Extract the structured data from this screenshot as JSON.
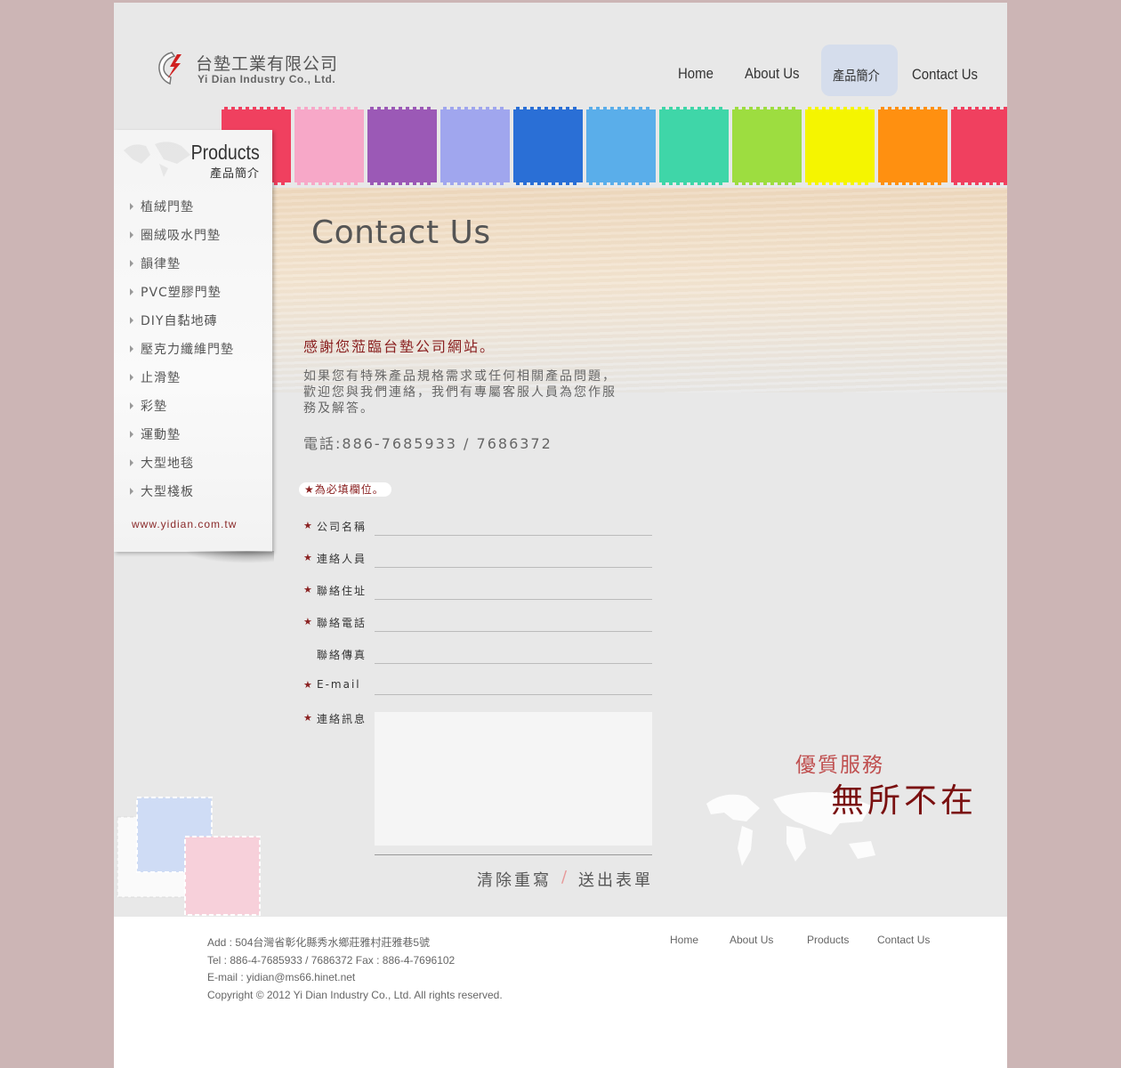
{
  "header": {
    "logo_cn": "台墊工業有限公司",
    "logo_en": "Yi Dian Industry Co., Ltd.",
    "nav": [
      {
        "label": "Home"
      },
      {
        "label": "About Us"
      },
      {
        "label": "產品簡介"
      },
      {
        "label": "Contact Us"
      }
    ]
  },
  "sidebar": {
    "title_en": "Products",
    "title_cn": "產品簡介",
    "items": [
      {
        "label": "植絨門墊"
      },
      {
        "label": "圈絨吸水門墊"
      },
      {
        "label": "韻律墊"
      },
      {
        "label": "PVC塑膠門墊"
      },
      {
        "label": "DIY自黏地磚"
      },
      {
        "label": "壓克力纖維門墊"
      },
      {
        "label": "止滑墊"
      },
      {
        "label": "彩墊"
      },
      {
        "label": "運動墊"
      },
      {
        "label": "大型地毯"
      },
      {
        "label": "大型棧板"
      }
    ],
    "url": "www.yidian.com.tw"
  },
  "content": {
    "title": "Contact Us",
    "thanks": "感謝您蒞臨台墊公司網站。",
    "intro": "如果您有特殊產品規格需求或任何相關產品問題，歡迎您與我們連絡，我們有專屬客服人員為您作服務及解答。",
    "phone": "電話:886-7685933 / 7686372",
    "required_note": "★為必填欄位。"
  },
  "form": {
    "fields": [
      {
        "label": "公司名稱",
        "required": true,
        "value": ""
      },
      {
        "label": "連絡人員",
        "required": true,
        "value": ""
      },
      {
        "label": "聯絡住址",
        "required": true,
        "value": ""
      },
      {
        "label": "聯絡電話",
        "required": true,
        "value": ""
      },
      {
        "label": "聯絡傳真",
        "required": false,
        "value": ""
      },
      {
        "label": "E-mail",
        "required": true,
        "value": ""
      }
    ],
    "message_label": "連絡訊息",
    "message_value": "",
    "star": "★",
    "reset_label": "清除重寫",
    "separator": "/",
    "submit_label": "送出表單"
  },
  "slogan": {
    "line1": "優質服務",
    "line2": "無所不在"
  },
  "footer": {
    "address": "Add : 504台灣省彰化縣秀水鄉莊雅村莊雅巷5號",
    "tel": "Tel : 886-4-7685933  /  7686372        Fax : 886-4-7696102",
    "email": "E-mail : yidian@ms66.hinet.net",
    "copyright": "Copyright © 2012 Yi Dian Industry Co., Ltd. All rights reserved.",
    "nav": [
      {
        "label": "Home"
      },
      {
        "label": "About Us"
      },
      {
        "label": "Products"
      },
      {
        "label": "Contact Us"
      }
    ]
  },
  "colors": {
    "page_bg": "#ccb5b5",
    "content_bg": "#e8e8e8",
    "accent_red": "#8a2020",
    "nav_active_bg": "#cfd9ec",
    "puzzle": [
      "#f0405f",
      "#f7a8c8",
      "#9b59b6",
      "#a0a6ee",
      "#2a6fd6",
      "#5aaeea",
      "#3fd6a8",
      "#9ddd40",
      "#f5f500",
      "#ff9010",
      "#f0405f"
    ]
  }
}
